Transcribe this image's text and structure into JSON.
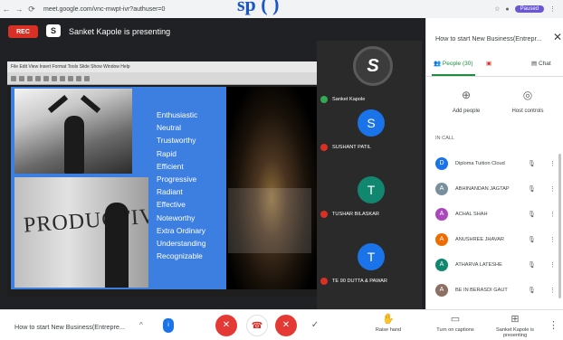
{
  "browser": {
    "back": "←",
    "forward": "→",
    "reload": "⟳",
    "url": "meet.google.com/vnc-mwpt-ivr?authuser=0",
    "profile": "Paused"
  },
  "overlay_title": "sp ( )",
  "stage": {
    "rec_label": "REC",
    "presenter_icon": "S",
    "presenter_text": "Sanket Kapole is presenting",
    "ppt_menu": "File  Edit  View  Insert  Format  Tools  Slide Show  Window  Help",
    "photo_word": "PRODUCTIVITY",
    "acrostic": [
      "Enthusiastic",
      "Neutral",
      "Trustworthy",
      "Rapid",
      "Efficient",
      "Progressive",
      "Radiant",
      "Effective",
      "Noteworthy",
      "Extra Ordinary",
      "Understanding",
      "Recognizable"
    ],
    "tiles": [
      {
        "initial": "S",
        "name": "Sanket Kapole",
        "color": "#3c3c3c"
      },
      {
        "initial": "S",
        "name": "SUSHANT PATIL",
        "color": "#1a73e8"
      },
      {
        "initial": "T",
        "name": "TUSHAR BILASKAR",
        "color": "#12876f"
      },
      {
        "initial": "T",
        "name": "TE 90 DUTTA & PAWAR",
        "color": "#1a73e8"
      }
    ]
  },
  "panel": {
    "title": "How to start New Business(Entrepr...",
    "close": "✕",
    "tabs": {
      "people": "People (30)",
      "chat": "Chat"
    },
    "actions": {
      "add_people": "Add people",
      "host_controls": "Host controls"
    },
    "section": "IN CALL",
    "people": [
      {
        "initial": "D",
        "name": "Diploma Tuition Cloud",
        "color": "#1a73e8"
      },
      {
        "initial": "A",
        "name": "ABHINANDAN JAGTAP",
        "color": "#78909c"
      },
      {
        "initial": "A",
        "name": "ACHAL SHAH",
        "color": "#ab47bc"
      },
      {
        "initial": "A",
        "name": "ANUSHREE JHAVAR",
        "color": "#ef6c00"
      },
      {
        "initial": "A",
        "name": "ATHARVA LATESHE",
        "color": "#12876f"
      },
      {
        "initial": "A",
        "name": "BE IN BERASDI GAUT",
        "color": "#8d6e63"
      }
    ]
  },
  "bottom": {
    "meeting_title": "How to start New Business(Entrepre...",
    "chevron": "^",
    "shield_icon": "i",
    "mic_icon": "✕",
    "hangup_icon": "☎",
    "cam_icon": "✕",
    "more_icon": "✓",
    "raise_hand": "Raise hand",
    "captions": "Turn on captions",
    "present": "Sanket Kapole is presenting",
    "more_dots": "⋮"
  }
}
